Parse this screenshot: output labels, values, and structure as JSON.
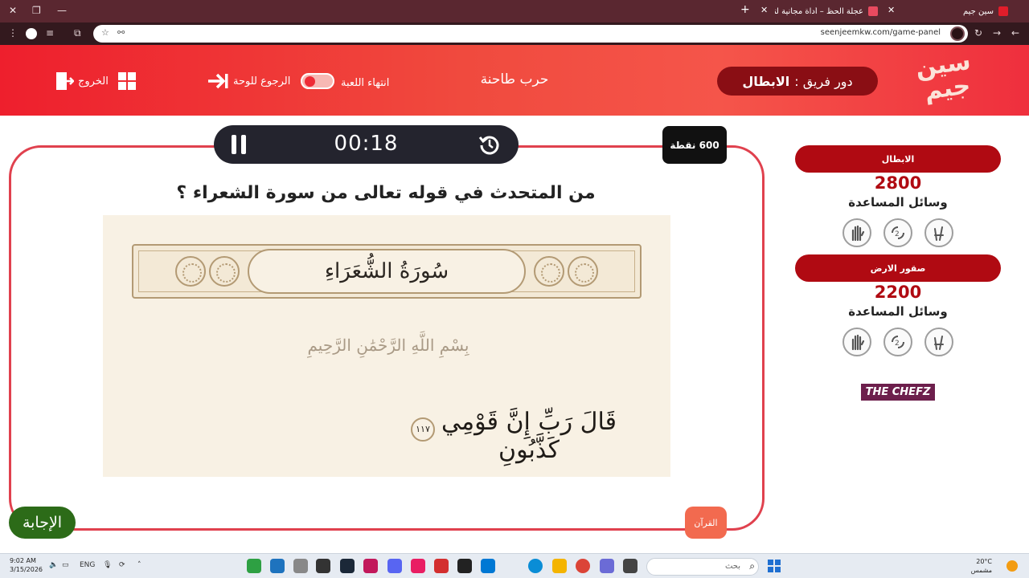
{
  "browser": {
    "tabs": [
      {
        "title": "سين جيم",
        "active": true
      },
      {
        "title": "عجلة الحظ – أداة مجانية لتدوير الـ",
        "active": false
      }
    ],
    "url": "seenjeemkw.com/game-panel"
  },
  "header": {
    "logo_text": "سين جيم",
    "turn_label": "دور فريق :",
    "turn_team": "الابطال",
    "category_title": "حرب طاحنة",
    "end_game_label": "انتهاء اللعبة",
    "back_to_board_label": "الرجوع للوحة",
    "exit_label": "الخروج"
  },
  "timer": {
    "value": "00:18"
  },
  "points_badge": "600 نقطة",
  "question": "من المتحدث في قوله تعالى من سورة الشعراء ؟",
  "quran": {
    "surah_title": "سُورَةُ الشُّعَرَاءِ",
    "basmala": "بِسْمِ اللَّهِ الرَّحْمَٰنِ الرَّحِيمِ",
    "verse": "قَالَ رَبِّ إِنَّ قَوْمِي كَذَّبُونِ",
    "ayah_number": "١١٧"
  },
  "answer_button": "الإجابة",
  "category_badge": "القرآن",
  "teams": [
    {
      "name": "الابطال",
      "score": "2800",
      "aids_label": "وسائل المساعدة"
    },
    {
      "name": "صقور الارض",
      "score": "2200",
      "aids_label": "وسائل المساعدة"
    }
  ],
  "sponsor": "THE CHEFZ",
  "taskbar": {
    "time": "9:02 AM",
    "date": "3/15/2026",
    "lang": "ENG",
    "search_placeholder": "بحث",
    "temperature": "20°C",
    "weather": "مشمس"
  },
  "colors": {
    "header_red": "#ee1f2d",
    "team_red": "#b00a12",
    "answer_green": "#2c6b18",
    "card_border": "#e0414e",
    "timer_bg": "#24242e"
  }
}
